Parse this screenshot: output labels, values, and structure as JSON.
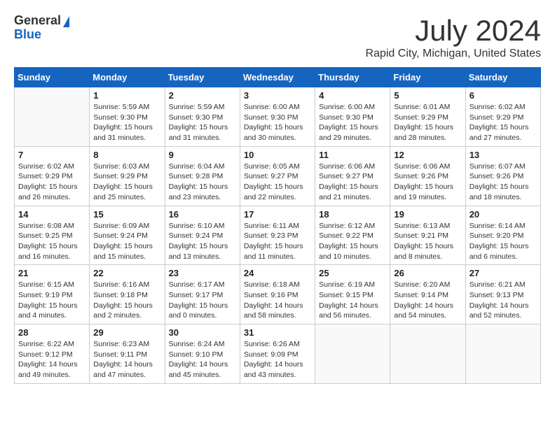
{
  "logo": {
    "general": "General",
    "blue": "Blue"
  },
  "title": "July 2024",
  "location": "Rapid City, Michigan, United States",
  "weekdays": [
    "Sunday",
    "Monday",
    "Tuesday",
    "Wednesday",
    "Thursday",
    "Friday",
    "Saturday"
  ],
  "weeks": [
    [
      {
        "day": "",
        "info": ""
      },
      {
        "day": "1",
        "info": "Sunrise: 5:59 AM\nSunset: 9:30 PM\nDaylight: 15 hours\nand 31 minutes."
      },
      {
        "day": "2",
        "info": "Sunrise: 5:59 AM\nSunset: 9:30 PM\nDaylight: 15 hours\nand 31 minutes."
      },
      {
        "day": "3",
        "info": "Sunrise: 6:00 AM\nSunset: 9:30 PM\nDaylight: 15 hours\nand 30 minutes."
      },
      {
        "day": "4",
        "info": "Sunrise: 6:00 AM\nSunset: 9:30 PM\nDaylight: 15 hours\nand 29 minutes."
      },
      {
        "day": "5",
        "info": "Sunrise: 6:01 AM\nSunset: 9:29 PM\nDaylight: 15 hours\nand 28 minutes."
      },
      {
        "day": "6",
        "info": "Sunrise: 6:02 AM\nSunset: 9:29 PM\nDaylight: 15 hours\nand 27 minutes."
      }
    ],
    [
      {
        "day": "7",
        "info": ""
      },
      {
        "day": "8",
        "info": "Sunrise: 6:03 AM\nSunset: 9:29 PM\nDaylight: 15 hours\nand 25 minutes."
      },
      {
        "day": "9",
        "info": "Sunrise: 6:04 AM\nSunset: 9:28 PM\nDaylight: 15 hours\nand 23 minutes."
      },
      {
        "day": "10",
        "info": "Sunrise: 6:05 AM\nSunset: 9:27 PM\nDaylight: 15 hours\nand 22 minutes."
      },
      {
        "day": "11",
        "info": "Sunrise: 6:06 AM\nSunset: 9:27 PM\nDaylight: 15 hours\nand 21 minutes."
      },
      {
        "day": "12",
        "info": "Sunrise: 6:06 AM\nSunset: 9:26 PM\nDaylight: 15 hours\nand 19 minutes."
      },
      {
        "day": "13",
        "info": "Sunrise: 6:07 AM\nSunset: 9:26 PM\nDaylight: 15 hours\nand 18 minutes."
      }
    ],
    [
      {
        "day": "14",
        "info": ""
      },
      {
        "day": "15",
        "info": "Sunrise: 6:09 AM\nSunset: 9:24 PM\nDaylight: 15 hours\nand 15 minutes."
      },
      {
        "day": "16",
        "info": "Sunrise: 6:10 AM\nSunset: 9:24 PM\nDaylight: 15 hours\nand 13 minutes."
      },
      {
        "day": "17",
        "info": "Sunrise: 6:11 AM\nSunset: 9:23 PM\nDaylight: 15 hours\nand 11 minutes."
      },
      {
        "day": "18",
        "info": "Sunrise: 6:12 AM\nSunset: 9:22 PM\nDaylight: 15 hours\nand 10 minutes."
      },
      {
        "day": "19",
        "info": "Sunrise: 6:13 AM\nSunset: 9:21 PM\nDaylight: 15 hours\nand 8 minutes."
      },
      {
        "day": "20",
        "info": "Sunrise: 6:14 AM\nSunset: 9:20 PM\nDaylight: 15 hours\nand 6 minutes."
      }
    ],
    [
      {
        "day": "21",
        "info": ""
      },
      {
        "day": "22",
        "info": "Sunrise: 6:16 AM\nSunset: 9:18 PM\nDaylight: 15 hours\nand 2 minutes."
      },
      {
        "day": "23",
        "info": "Sunrise: 6:17 AM\nSunset: 9:17 PM\nDaylight: 15 hours\nand 0 minutes."
      },
      {
        "day": "24",
        "info": "Sunrise: 6:18 AM\nSunset: 9:16 PM\nDaylight: 14 hours\nand 58 minutes."
      },
      {
        "day": "25",
        "info": "Sunrise: 6:19 AM\nSunset: 9:15 PM\nDaylight: 14 hours\nand 56 minutes."
      },
      {
        "day": "26",
        "info": "Sunrise: 6:20 AM\nSunset: 9:14 PM\nDaylight: 14 hours\nand 54 minutes."
      },
      {
        "day": "27",
        "info": "Sunrise: 6:21 AM\nSunset: 9:13 PM\nDaylight: 14 hours\nand 52 minutes."
      }
    ],
    [
      {
        "day": "28",
        "info": "Sunrise: 6:22 AM\nSunset: 9:12 PM\nDaylight: 14 hours\nand 49 minutes."
      },
      {
        "day": "29",
        "info": "Sunrise: 6:23 AM\nSunset: 9:11 PM\nDaylight: 14 hours\nand 47 minutes."
      },
      {
        "day": "30",
        "info": "Sunrise: 6:24 AM\nSunset: 9:10 PM\nDaylight: 14 hours\nand 45 minutes."
      },
      {
        "day": "31",
        "info": "Sunrise: 6:26 AM\nSunset: 9:09 PM\nDaylight: 14 hours\nand 43 minutes."
      },
      {
        "day": "",
        "info": ""
      },
      {
        "day": "",
        "info": ""
      },
      {
        "day": "",
        "info": ""
      }
    ]
  ],
  "week1_sunday": "Sunrise: 6:02 AM\nSunset: 9:29 PM\nDaylight: 15 hours\nand 26 minutes.",
  "week2_sunday": "Sunrise: 6:08 AM\nSunset: 9:25 PM\nDaylight: 15 hours\nand 16 minutes.",
  "week3_sunday": "Sunrise: 6:15 AM\nSunset: 9:19 PM\nDaylight: 15 hours\nand 4 minutes."
}
